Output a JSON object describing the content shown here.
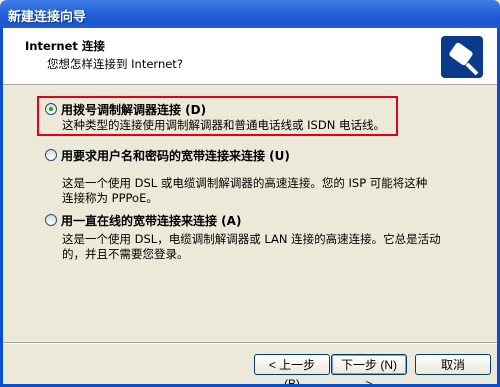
{
  "window": {
    "title": "新建连接向导"
  },
  "header": {
    "title": "Internet 连接",
    "subtitle": "您想怎样连接到 Internet?",
    "icon": "network-connection-icon"
  },
  "options": [
    {
      "label": "用拨号调制解调器连接 (D)",
      "description": "这种类型的连接使用调制解调器和普通电话线或 ISDN 电话线。",
      "selected": true
    },
    {
      "label": "用要求用户名和密码的宽带连接来连接 (U)",
      "description_lines": [
        "这是一个使用 DSL 或电缆调制解调器的高速连接。您的 ISP 可能将这种",
        "连接称为 PPPoE。"
      ],
      "selected": false
    },
    {
      "label": "用一直在线的宽带连接来连接 (A)",
      "description_lines": [
        "这是一个使用 DSL，电缆调制解调器或 LAN 连接的高速连接。它总是活动",
        "的，并且不需要您登录。"
      ],
      "selected": false
    }
  ],
  "buttons": {
    "back": "< 上一步 (B)",
    "next": "下一步 (N) >",
    "cancel": "取消"
  },
  "colors": {
    "title_bar": "#2563d6",
    "highlight_border": "#e3001b",
    "radio_selected": "#21a121"
  }
}
